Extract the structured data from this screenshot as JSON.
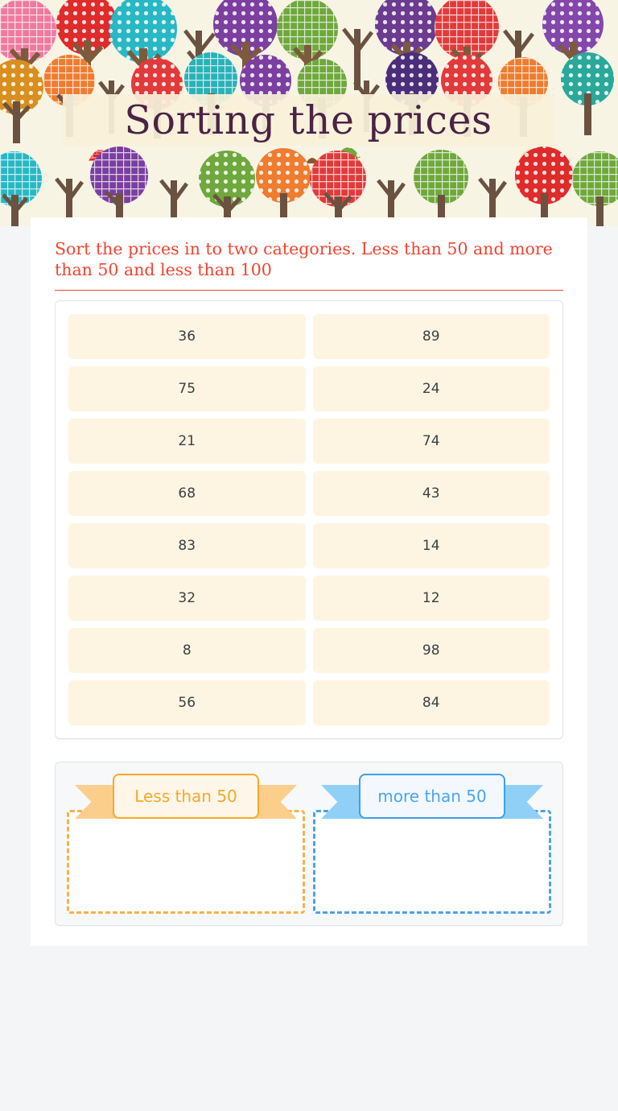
{
  "header": {
    "title": "Sorting the prices",
    "background_pattern": "tree-pattern",
    "banner_color": "#f9f0d9",
    "title_color": "#4b2346"
  },
  "instructions": {
    "text": "Sort the prices in to two categories. Less than 50 and more than 50 and less than 100",
    "color": "#f2432f"
  },
  "tiles": [
    {
      "value": "36"
    },
    {
      "value": "89"
    },
    {
      "value": "75"
    },
    {
      "value": "24"
    },
    {
      "value": "21"
    },
    {
      "value": "74"
    },
    {
      "value": "68"
    },
    {
      "value": "43"
    },
    {
      "value": "83"
    },
    {
      "value": "14"
    },
    {
      "value": "32"
    },
    {
      "value": "12"
    },
    {
      "value": "8"
    },
    {
      "value": "98"
    },
    {
      "value": "56"
    },
    {
      "value": "84"
    }
  ],
  "drop_zones": [
    {
      "label": "Less than 50",
      "color": "#f6a928",
      "tail_color": "#fbce8c",
      "items": []
    },
    {
      "label": "more than 50",
      "color": "#3ea0ea",
      "tail_color": "#90d0f7",
      "items": []
    }
  ],
  "colors": {
    "page_background": "#f4f5f7",
    "panel_background": "#ffffff",
    "tile_background": "#fdf5e2",
    "tile_text": "#3b4045",
    "divider": "#ef4a36"
  }
}
